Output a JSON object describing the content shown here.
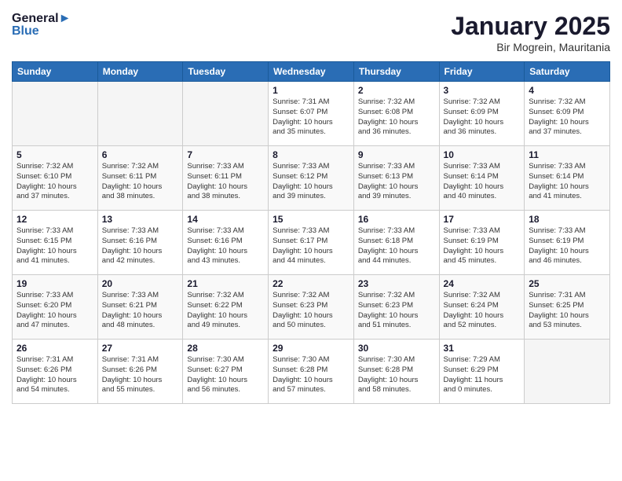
{
  "header": {
    "logo_line1": "General",
    "logo_line2": "Blue",
    "month": "January 2025",
    "location": "Bir Mogrein, Mauritania"
  },
  "weekdays": [
    "Sunday",
    "Monday",
    "Tuesday",
    "Wednesday",
    "Thursday",
    "Friday",
    "Saturday"
  ],
  "weeks": [
    [
      {
        "day": "",
        "info": ""
      },
      {
        "day": "",
        "info": ""
      },
      {
        "day": "",
        "info": ""
      },
      {
        "day": "1",
        "info": "Sunrise: 7:31 AM\nSunset: 6:07 PM\nDaylight: 10 hours\nand 35 minutes."
      },
      {
        "day": "2",
        "info": "Sunrise: 7:32 AM\nSunset: 6:08 PM\nDaylight: 10 hours\nand 36 minutes."
      },
      {
        "day": "3",
        "info": "Sunrise: 7:32 AM\nSunset: 6:09 PM\nDaylight: 10 hours\nand 36 minutes."
      },
      {
        "day": "4",
        "info": "Sunrise: 7:32 AM\nSunset: 6:09 PM\nDaylight: 10 hours\nand 37 minutes."
      }
    ],
    [
      {
        "day": "5",
        "info": "Sunrise: 7:32 AM\nSunset: 6:10 PM\nDaylight: 10 hours\nand 37 minutes."
      },
      {
        "day": "6",
        "info": "Sunrise: 7:32 AM\nSunset: 6:11 PM\nDaylight: 10 hours\nand 38 minutes."
      },
      {
        "day": "7",
        "info": "Sunrise: 7:33 AM\nSunset: 6:11 PM\nDaylight: 10 hours\nand 38 minutes."
      },
      {
        "day": "8",
        "info": "Sunrise: 7:33 AM\nSunset: 6:12 PM\nDaylight: 10 hours\nand 39 minutes."
      },
      {
        "day": "9",
        "info": "Sunrise: 7:33 AM\nSunset: 6:13 PM\nDaylight: 10 hours\nand 39 minutes."
      },
      {
        "day": "10",
        "info": "Sunrise: 7:33 AM\nSunset: 6:14 PM\nDaylight: 10 hours\nand 40 minutes."
      },
      {
        "day": "11",
        "info": "Sunrise: 7:33 AM\nSunset: 6:14 PM\nDaylight: 10 hours\nand 41 minutes."
      }
    ],
    [
      {
        "day": "12",
        "info": "Sunrise: 7:33 AM\nSunset: 6:15 PM\nDaylight: 10 hours\nand 41 minutes."
      },
      {
        "day": "13",
        "info": "Sunrise: 7:33 AM\nSunset: 6:16 PM\nDaylight: 10 hours\nand 42 minutes."
      },
      {
        "day": "14",
        "info": "Sunrise: 7:33 AM\nSunset: 6:16 PM\nDaylight: 10 hours\nand 43 minutes."
      },
      {
        "day": "15",
        "info": "Sunrise: 7:33 AM\nSunset: 6:17 PM\nDaylight: 10 hours\nand 44 minutes."
      },
      {
        "day": "16",
        "info": "Sunrise: 7:33 AM\nSunset: 6:18 PM\nDaylight: 10 hours\nand 44 minutes."
      },
      {
        "day": "17",
        "info": "Sunrise: 7:33 AM\nSunset: 6:19 PM\nDaylight: 10 hours\nand 45 minutes."
      },
      {
        "day": "18",
        "info": "Sunrise: 7:33 AM\nSunset: 6:19 PM\nDaylight: 10 hours\nand 46 minutes."
      }
    ],
    [
      {
        "day": "19",
        "info": "Sunrise: 7:33 AM\nSunset: 6:20 PM\nDaylight: 10 hours\nand 47 minutes."
      },
      {
        "day": "20",
        "info": "Sunrise: 7:33 AM\nSunset: 6:21 PM\nDaylight: 10 hours\nand 48 minutes."
      },
      {
        "day": "21",
        "info": "Sunrise: 7:32 AM\nSunset: 6:22 PM\nDaylight: 10 hours\nand 49 minutes."
      },
      {
        "day": "22",
        "info": "Sunrise: 7:32 AM\nSunset: 6:23 PM\nDaylight: 10 hours\nand 50 minutes."
      },
      {
        "day": "23",
        "info": "Sunrise: 7:32 AM\nSunset: 6:23 PM\nDaylight: 10 hours\nand 51 minutes."
      },
      {
        "day": "24",
        "info": "Sunrise: 7:32 AM\nSunset: 6:24 PM\nDaylight: 10 hours\nand 52 minutes."
      },
      {
        "day": "25",
        "info": "Sunrise: 7:31 AM\nSunset: 6:25 PM\nDaylight: 10 hours\nand 53 minutes."
      }
    ],
    [
      {
        "day": "26",
        "info": "Sunrise: 7:31 AM\nSunset: 6:26 PM\nDaylight: 10 hours\nand 54 minutes."
      },
      {
        "day": "27",
        "info": "Sunrise: 7:31 AM\nSunset: 6:26 PM\nDaylight: 10 hours\nand 55 minutes."
      },
      {
        "day": "28",
        "info": "Sunrise: 7:30 AM\nSunset: 6:27 PM\nDaylight: 10 hours\nand 56 minutes."
      },
      {
        "day": "29",
        "info": "Sunrise: 7:30 AM\nSunset: 6:28 PM\nDaylight: 10 hours\nand 57 minutes."
      },
      {
        "day": "30",
        "info": "Sunrise: 7:30 AM\nSunset: 6:28 PM\nDaylight: 10 hours\nand 58 minutes."
      },
      {
        "day": "31",
        "info": "Sunrise: 7:29 AM\nSunset: 6:29 PM\nDaylight: 11 hours\nand 0 minutes."
      },
      {
        "day": "",
        "info": ""
      }
    ]
  ]
}
